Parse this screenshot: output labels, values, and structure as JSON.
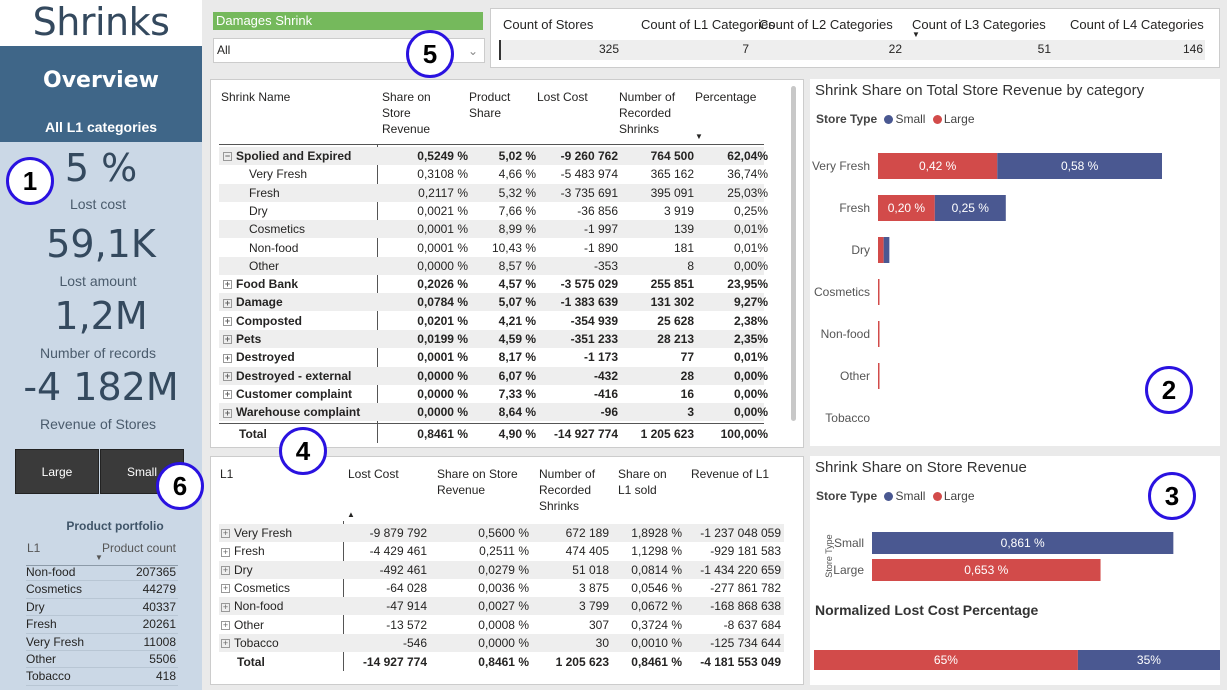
{
  "app_title": "Shrinks",
  "sidebar": {
    "overview": "Overview",
    "category": "All L1 categories",
    "kpis": [
      {
        "value": "5 %",
        "label": "Lost cost"
      },
      {
        "value": "59,1K",
        "label": "Lost amount"
      },
      {
        "value": "1,2M",
        "label": "Number of records"
      },
      {
        "value": "-4 182M",
        "label": "Revenue of Stores"
      }
    ],
    "buttons": {
      "large": "Large",
      "small": "Small"
    },
    "portfolio": {
      "title": "Product portfolio",
      "col1": "L1",
      "col2": "Product count",
      "rows": [
        {
          "l1": "Non-food",
          "count": "207365"
        },
        {
          "l1": "Cosmetics",
          "count": "44279"
        },
        {
          "l1": "Dry",
          "count": "40337"
        },
        {
          "l1": "Fresh",
          "count": "20261"
        },
        {
          "l1": "Very Fresh",
          "count": "11008"
        },
        {
          "l1": "Other",
          "count": "5506"
        },
        {
          "l1": "Tobacco",
          "count": "418"
        }
      ]
    }
  },
  "slicer": {
    "header": "Damages Shrink",
    "value": "All"
  },
  "counts": [
    {
      "label": "Count of Stores",
      "value": "325"
    },
    {
      "label": "Count of L1 Categories",
      "value": "7"
    },
    {
      "label": "Count of L2 Categories",
      "value": "22"
    },
    {
      "label": "Count of L3 Categories",
      "value": "51"
    },
    {
      "label": "Count of L4 Categories",
      "value": "146"
    }
  ],
  "shrink_table": {
    "headers": [
      "Shrink Name",
      "Share on Store Revenue",
      "Product Share",
      "Lost Cost",
      "Number of Recorded Shrinks",
      "Percentage"
    ],
    "rows": [
      {
        "name": "Spolied and Expired",
        "level": 0,
        "expanded": true,
        "bold": true,
        "v": [
          "0,5249 %",
          "5,02 %",
          "-9 260 762",
          "764 500",
          "62,04%"
        ]
      },
      {
        "name": "Very Fresh",
        "level": 1,
        "v": [
          "0,3108 %",
          "4,66 %",
          "-5 483 974",
          "365 162",
          "36,74%"
        ]
      },
      {
        "name": "Fresh",
        "level": 1,
        "v": [
          "0,2117 %",
          "5,32 %",
          "-3 735 691",
          "395 091",
          "25,03%"
        ]
      },
      {
        "name": "Dry",
        "level": 1,
        "v": [
          "0,0021 %",
          "7,66 %",
          "-36 856",
          "3 919",
          "0,25%"
        ]
      },
      {
        "name": "Cosmetics",
        "level": 1,
        "v": [
          "0,0001 %",
          "8,99 %",
          "-1 997",
          "139",
          "0,01%"
        ]
      },
      {
        "name": "Non-food",
        "level": 1,
        "v": [
          "0,0001 %",
          "10,43 %",
          "-1 890",
          "181",
          "0,01%"
        ]
      },
      {
        "name": "Other",
        "level": 1,
        "v": [
          "0,0000 %",
          "8,57 %",
          "-353",
          "8",
          "0,00%"
        ]
      },
      {
        "name": "Food Bank",
        "level": 0,
        "bold": true,
        "v": [
          "0,2026 %",
          "4,57 %",
          "-3 575 029",
          "255 851",
          "23,95%"
        ]
      },
      {
        "name": "Damage",
        "level": 0,
        "bold": true,
        "v": [
          "0,0784 %",
          "5,07 %",
          "-1 383 639",
          "131 302",
          "9,27%"
        ]
      },
      {
        "name": "Composted",
        "level": 0,
        "bold": true,
        "v": [
          "0,0201 %",
          "4,21 %",
          "-354 939",
          "25 628",
          "2,38%"
        ]
      },
      {
        "name": "Pets",
        "level": 0,
        "bold": true,
        "v": [
          "0,0199 %",
          "4,59 %",
          "-351 233",
          "28 213",
          "2,35%"
        ]
      },
      {
        "name": "Destroyed",
        "level": 0,
        "bold": true,
        "v": [
          "0,0001 %",
          "8,17 %",
          "-1 173",
          "77",
          "0,01%"
        ]
      },
      {
        "name": "Destroyed - external",
        "level": 0,
        "bold": true,
        "v": [
          "0,0000 %",
          "6,07 %",
          "-432",
          "28",
          "0,00%"
        ]
      },
      {
        "name": "Customer complaint",
        "level": 0,
        "bold": true,
        "v": [
          "0,0000 %",
          "7,33 %",
          "-416",
          "16",
          "0,00%"
        ]
      },
      {
        "name": "Warehouse complaint",
        "level": 0,
        "bold": true,
        "v": [
          "0,0000 %",
          "8,64 %",
          "-96",
          "3",
          "0,00%"
        ]
      }
    ],
    "total": {
      "name": "Total",
      "v": [
        "0,8461 %",
        "4,90 %",
        "-14 927 774",
        "1 205 623",
        "100,00%"
      ]
    }
  },
  "l1_table": {
    "headers": [
      "L1",
      "Lost Cost",
      "Share on Store Revenue",
      "Number of Recorded Shrinks",
      "Share on L1 sold",
      "Revenue of L1"
    ],
    "rows": [
      {
        "name": "Very Fresh",
        "v": [
          "-9 879 792",
          "0,5600 %",
          "672 189",
          "1,8928 %",
          "-1 237 048 059"
        ]
      },
      {
        "name": "Fresh",
        "v": [
          "-4 429 461",
          "0,2511 %",
          "474 405",
          "1,1298 %",
          "-929 181 583"
        ]
      },
      {
        "name": "Dry",
        "v": [
          "-492 461",
          "0,0279 %",
          "51 018",
          "0,0814 %",
          "-1 434 220 659"
        ]
      },
      {
        "name": "Cosmetics",
        "v": [
          "-64 028",
          "0,0036 %",
          "3 875",
          "0,0546 %",
          "-277 861 782"
        ]
      },
      {
        "name": "Non-food",
        "v": [
          "-47 914",
          "0,0027 %",
          "3 799",
          "0,0672 %",
          "-168 868 638"
        ]
      },
      {
        "name": "Other",
        "v": [
          "-13 572",
          "0,0008 %",
          "307",
          "0,3724 %",
          "-8 637 684"
        ]
      },
      {
        "name": "Tobacco",
        "v": [
          "-546",
          "0,0000 %",
          "30",
          "0,0010 %",
          "-125 734 644"
        ]
      }
    ],
    "total": {
      "name": "Total",
      "v": [
        "-14 927 774",
        "0,8461 %",
        "1 205 623",
        "0,8461 %",
        "-4 181 553 049"
      ]
    }
  },
  "colors": {
    "small": "#4a5891",
    "large": "#d24b4a",
    "sidebar": "#cbd8e6",
    "overview": "#3f6688",
    "slicer": "#75b95c",
    "circle": "#2a12e0"
  },
  "chart_data": [
    {
      "type": "bar",
      "orientation": "horizontal",
      "stacked": true,
      "title": "Shrink Share on Total Store Revenue by category",
      "legend_title": "Store Type",
      "categories": [
        "Very Fresh",
        "Fresh",
        "Dry",
        "Cosmetics",
        "Non-food",
        "Other",
        "Tobacco"
      ],
      "series": [
        {
          "name": "Large",
          "values": [
            0.42,
            0.2,
            0.02,
            0.004,
            0.003,
            0.0008,
            0
          ]
        },
        {
          "name": "Small",
          "values": [
            0.58,
            0.25,
            0.02,
            0.0,
            0.0,
            0.0,
            0
          ]
        }
      ],
      "data_labels": [
        [
          "0,42 %",
          "0,58 %"
        ],
        [
          "0,20 %",
          "0,25 %"
        ]
      ]
    },
    {
      "type": "bar",
      "orientation": "horizontal",
      "title": "Shrink Share on Store Revenue",
      "legend_title": "Store Type",
      "ylabel": "Store Type",
      "categories": [
        "Small",
        "Large"
      ],
      "values": [
        0.861,
        0.653
      ],
      "labels": [
        "0,861 %",
        "0,653 %"
      ]
    },
    {
      "type": "bar",
      "orientation": "horizontal",
      "stacked": true,
      "percent": true,
      "title": "Normalized Lost Cost Percentage",
      "series": [
        {
          "name": "Large",
          "values": [
            65
          ]
        },
        {
          "name": "Small",
          "values": [
            35
          ]
        }
      ],
      "labels": [
        "65%",
        "35%"
      ]
    }
  ],
  "circles": [
    "1",
    "2",
    "3",
    "4",
    "5",
    "6"
  ]
}
